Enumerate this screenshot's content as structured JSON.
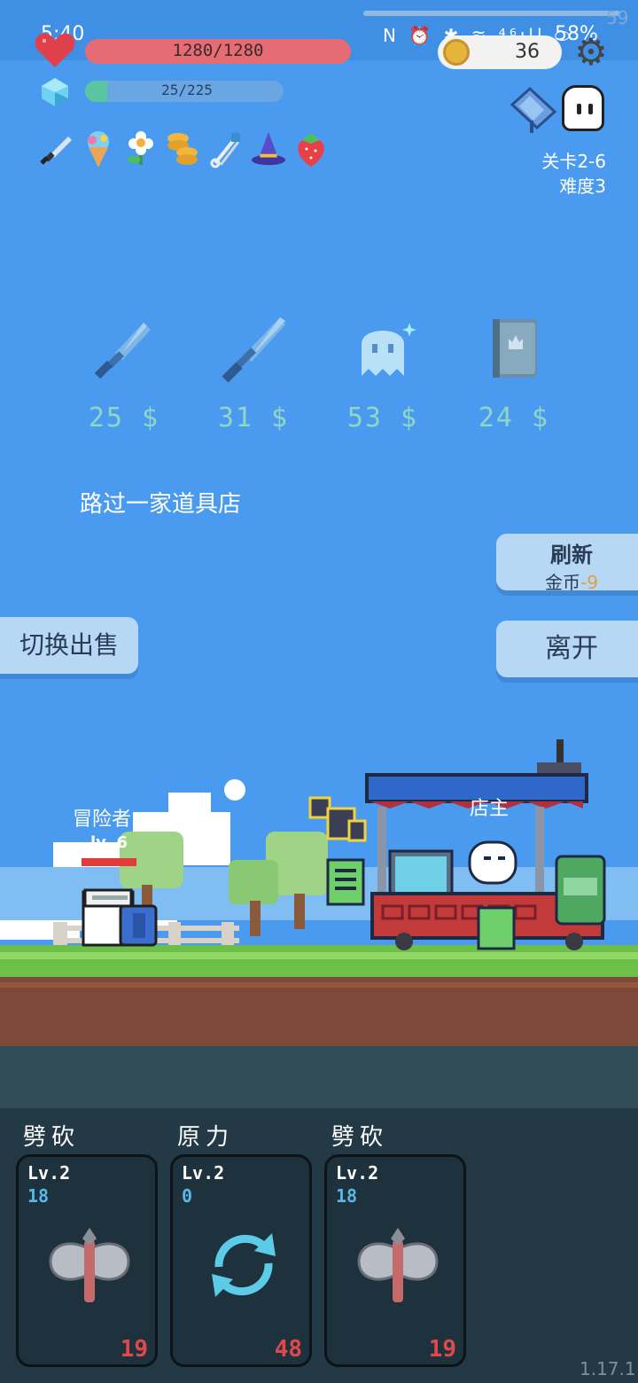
{
  "status_bar": {
    "time": "5:40",
    "icons": "N ⏰ ✱ ≋ ⁴⁶ıll ⬭",
    "battery": "58%",
    "fps": "59"
  },
  "player": {
    "hp_text": "1280/1280",
    "hp_fraction": 1.0,
    "xp_text": "25/225",
    "xp_fraction": 0.111
  },
  "currency": {
    "coins": "36"
  },
  "relics": [
    "dagger-relic-icon",
    "ice-cream-icon",
    "flower-icon",
    "coin-stack-icon",
    "safety-pin-icon",
    "wizard-hat-icon",
    "strawberry-icon"
  ],
  "stage": {
    "level": "关卡2-6",
    "difficulty": "难度3"
  },
  "shop": {
    "items": [
      {
        "name": "dagger-icon",
        "price": "25 $"
      },
      {
        "name": "sword-icon",
        "price": "31 $"
      },
      {
        "name": "ghost-icon",
        "price": "53 $"
      },
      {
        "name": "book-icon",
        "price": "24 $"
      }
    ],
    "event_text": "路过一家道具店",
    "refresh_label": "刷新",
    "refresh_cost_label": "金币",
    "refresh_cost_value": "-9",
    "leave_label": "离开",
    "switch_label": "切换出售"
  },
  "scene": {
    "hero_name": "冒险者",
    "hero_level": "lv. 6",
    "shopkeeper_label": "店主"
  },
  "cards": [
    {
      "title": "劈砍",
      "level": "Lv.2",
      "value": "18",
      "cost": "19",
      "icon": "axe-icon"
    },
    {
      "title": "原力",
      "level": "Lv.2",
      "value": "0",
      "cost": "48",
      "icon": "refresh-cycle-icon"
    },
    {
      "title": "劈砍",
      "level": "Lv.2",
      "value": "18",
      "cost": "19",
      "icon": "axe-icon"
    }
  ],
  "version": "1.17.1",
  "colors": {
    "sky": "#4a9bef",
    "hp": "#e56b74",
    "xp": "#59c6a0",
    "price": "#8fd6c6",
    "button": "#b7d8f5",
    "card_bg": "#1e323d",
    "cost": "#e0484c"
  }
}
